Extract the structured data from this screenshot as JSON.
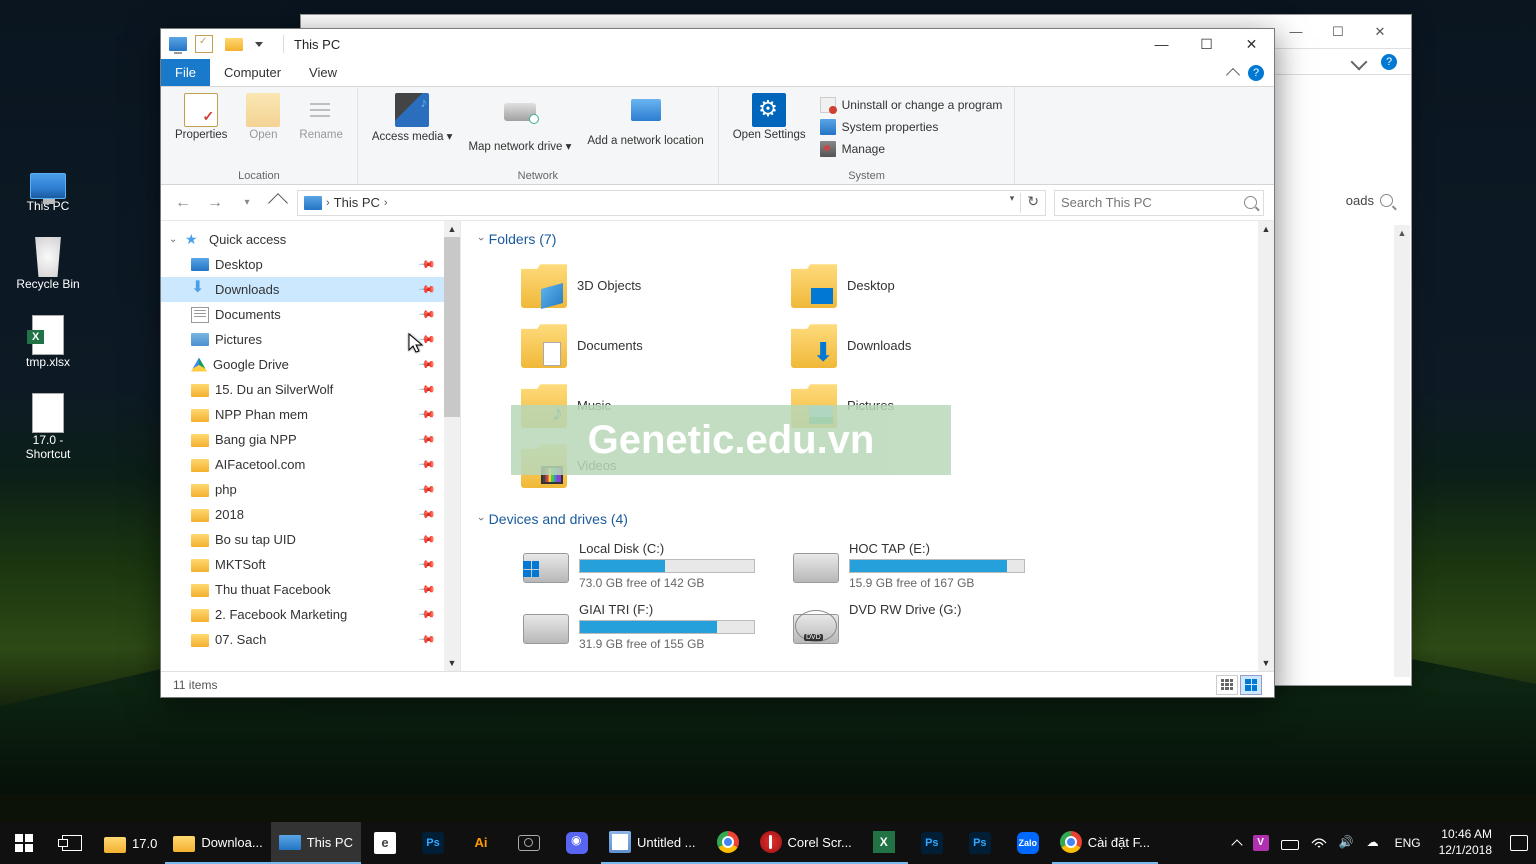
{
  "desktop": {
    "icons": [
      {
        "name": "this-pc",
        "label": "This PC"
      },
      {
        "name": "recycle-bin",
        "label": "Recycle Bin"
      },
      {
        "name": "tmp-xlsx",
        "label": "tmp.xlsx"
      },
      {
        "name": "shortcut-17",
        "label": "17.0 - Shortcut"
      }
    ]
  },
  "background_window": {
    "controls": {
      "minimize": "—",
      "maximize": "☐",
      "close": "✕"
    },
    "address_visible": "oads",
    "help": "?"
  },
  "window": {
    "title": "This PC",
    "tabs": {
      "file": "File",
      "computer": "Computer",
      "view": "View"
    },
    "controls": {
      "minimize": "—",
      "maximize": "☐",
      "close": "✕"
    },
    "help": "?",
    "ribbon": {
      "location": {
        "label": "Location",
        "properties": "Properties",
        "open": "Open",
        "rename": "Rename"
      },
      "network": {
        "label": "Network",
        "access_media": "Access media ▾",
        "map_drive": "Map network drive ▾",
        "add_location": "Add a network location"
      },
      "system": {
        "label": "System",
        "open_settings": "Open Settings",
        "uninstall": "Uninstall or change a program",
        "sys_props": "System properties",
        "manage": "Manage"
      }
    },
    "address": {
      "segment": "This PC"
    },
    "search": {
      "placeholder": "Search This PC"
    },
    "nav_pane": {
      "quick_access": "Quick access",
      "items": [
        {
          "label": "Desktop",
          "ico": "desktop",
          "pin": true
        },
        {
          "label": "Downloads",
          "ico": "downloads",
          "pin": true,
          "sel": true
        },
        {
          "label": "Documents",
          "ico": "documents",
          "pin": true
        },
        {
          "label": "Pictures",
          "ico": "pictures",
          "pin": true
        },
        {
          "label": "Google Drive",
          "ico": "gdrive",
          "pin": true
        },
        {
          "label": "15. Du an SilverWolf",
          "ico": "folder",
          "pin": true
        },
        {
          "label": "NPP Phan mem",
          "ico": "folder",
          "pin": true
        },
        {
          "label": "Bang gia NPP",
          "ico": "folder",
          "pin": true
        },
        {
          "label": "AIFacetool.com",
          "ico": "folder",
          "pin": true
        },
        {
          "label": "php",
          "ico": "folder",
          "pin": true
        },
        {
          "label": "2018",
          "ico": "folder",
          "pin": true
        },
        {
          "label": "Bo su tap UID",
          "ico": "folder",
          "pin": true
        },
        {
          "label": "MKTSoft",
          "ico": "folder",
          "pin": true
        },
        {
          "label": "Thu thuat Facebook",
          "ico": "folder",
          "pin": true
        },
        {
          "label": "2. Facebook Marketing",
          "ico": "folder",
          "pin": true
        },
        {
          "label": "07. Sach",
          "ico": "folder",
          "pin": true
        }
      ]
    },
    "content": {
      "folders_header": "Folders (7)",
      "folders": [
        {
          "label": "3D Objects",
          "ov": "3d"
        },
        {
          "label": "Desktop",
          "ov": "desktop"
        },
        {
          "label": "Documents",
          "ov": "doc"
        },
        {
          "label": "Downloads",
          "ov": "dl"
        },
        {
          "label": "Music",
          "ov": "music"
        },
        {
          "label": "Pictures",
          "ov": "pic"
        },
        {
          "label": "Videos",
          "ov": "vid"
        }
      ],
      "drives_header": "Devices and drives (4)",
      "drives": [
        {
          "label": "Local Disk (C:)",
          "free": "73.0 GB free of 142 GB",
          "fill": 49,
          "ico": "win"
        },
        {
          "label": "HOC TAP (E:)",
          "free": "15.9 GB free of 167 GB",
          "fill": 90,
          "ico": "hdd"
        },
        {
          "label": "GIAI TRI (F:)",
          "free": "31.9 GB free of 155 GB",
          "fill": 79,
          "ico": "hdd"
        },
        {
          "label": "DVD RW Drive (G:)",
          "free": "",
          "fill": 0,
          "ico": "dvd"
        }
      ]
    },
    "status": {
      "items": "11 items"
    }
  },
  "watermark": "Genetic.edu.vn",
  "taskbar": {
    "items": [
      {
        "name": "folder-17",
        "label": "17.0",
        "ico": "folder"
      },
      {
        "name": "downloads",
        "label": "Downloa...",
        "ico": "folder",
        "running": true
      },
      {
        "name": "this-pc",
        "label": "This PC",
        "ico": "pc",
        "active": true
      },
      {
        "name": "edge",
        "label": "",
        "ico": "edge"
      },
      {
        "name": "photoshop",
        "label": "",
        "ico": "ps"
      },
      {
        "name": "illustrator",
        "label": "",
        "ico": "ai"
      },
      {
        "name": "camera",
        "label": "",
        "ico": "cam"
      },
      {
        "name": "discord",
        "label": "",
        "ico": "discord"
      },
      {
        "name": "notepad",
        "label": "Untitled ...",
        "ico": "notepad",
        "running": true
      },
      {
        "name": "chrome",
        "label": "",
        "ico": "chrome",
        "running": true
      },
      {
        "name": "corel",
        "label": "Corel Scr...",
        "ico": "corel",
        "running": true
      },
      {
        "name": "excel",
        "label": "",
        "ico": "excel",
        "running": true
      },
      {
        "name": "app2",
        "label": "",
        "ico": "ps"
      },
      {
        "name": "app3",
        "label": "",
        "ico": "ps"
      },
      {
        "name": "zalo",
        "label": "",
        "ico": "zalo"
      },
      {
        "name": "chrome2",
        "label": "Cài đặt F...",
        "ico": "chrome",
        "running": true
      }
    ],
    "tray": {
      "lang": "ENG",
      "time": "10:46 AM",
      "date": "12/1/2018"
    }
  }
}
